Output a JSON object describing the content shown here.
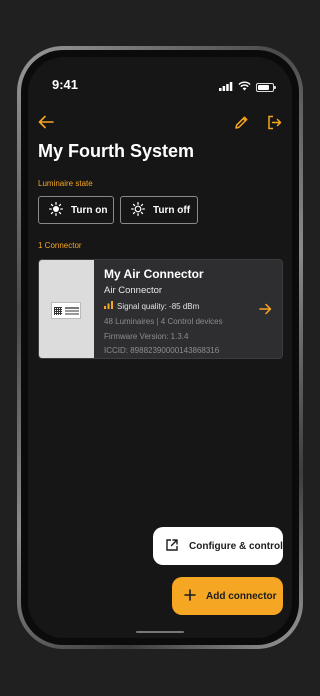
{
  "status_bar": {
    "time": "9:41"
  },
  "header": {
    "title": "My Fourth System"
  },
  "luminaire_state": {
    "label": "Luminaire state",
    "turn_on_label": "Turn on",
    "turn_off_label": "Turn off"
  },
  "connectors": {
    "count_label": "1 Connector",
    "items": [
      {
        "name": "My Air Connector",
        "type": "Air Connector",
        "signal": "Signal quality: -85 dBm",
        "devices": "48 Luminaires | 4 Control devices",
        "firmware": "Firmware Version: 1.3.4",
        "iccid": "ICCID: 89882390000143868316"
      }
    ]
  },
  "actions": {
    "configure_label": "Configure & control",
    "add_label": "Add connector"
  },
  "colors": {
    "accent": "#f5a623",
    "background": "#161616",
    "card": "#2e2e30"
  },
  "icons": [
    "back-arrow-icon",
    "pencil-icon",
    "logout-icon",
    "sun-icon",
    "sun-outline-icon",
    "signal-icon",
    "arrow-right-icon",
    "external-link-icon",
    "plus-icon"
  ]
}
